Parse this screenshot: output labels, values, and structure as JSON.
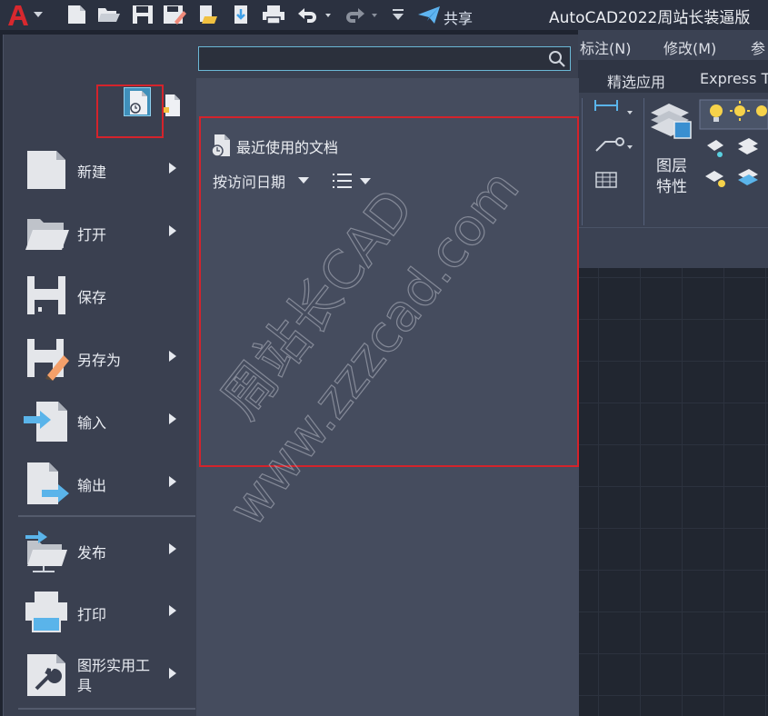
{
  "window": {
    "title": "AutoCAD2022周站长装逼版"
  },
  "quick_access": {
    "items": [
      "new-icon",
      "open-icon",
      "save-icon",
      "saveas-icon",
      "open-web-mobile-icon",
      "save-web-mobile-icon",
      "plot-icon",
      "undo-icon",
      "redo-icon",
      "customize-dropdown-icon"
    ],
    "share_label": "共享"
  },
  "menubar": {
    "items": [
      "标注(N)",
      "修改(M)",
      "参"
    ]
  },
  "ribbon": {
    "tabs": [
      "精选应用",
      "Express T"
    ],
    "layer_panel_label_line1": "图层",
    "layer_panel_label_line2": "特性"
  },
  "search": {
    "value": "",
    "placeholder": ""
  },
  "app_menu": {
    "items": [
      {
        "label": "新建",
        "icon": "new-doc-icon",
        "has_arrow": true
      },
      {
        "label": "打开",
        "icon": "open-folder-icon",
        "has_arrow": true
      },
      {
        "label": "保存",
        "icon": "save-disk-icon",
        "has_arrow": false
      },
      {
        "label": "另存为",
        "icon": "save-as-icon",
        "has_arrow": true
      },
      {
        "label": "输入",
        "icon": "import-icon",
        "has_arrow": true
      },
      {
        "label": "输出",
        "icon": "export-icon",
        "has_arrow": true
      },
      {
        "label": "发布",
        "icon": "publish-icon",
        "has_arrow": true
      },
      {
        "label": "打印",
        "icon": "print-icon",
        "has_arrow": true
      },
      {
        "label": "图形实用工具",
        "icon": "drawing-utilities-icon",
        "has_arrow": true
      }
    ]
  },
  "recent": {
    "title": "最近使用的文档",
    "sort_label": "按访问日期"
  },
  "watermark": {
    "line1": "周站长CAD",
    "line2": "www.zzzcad.com"
  },
  "colors": {
    "highlight": "#d4232b",
    "panel": "#454c5e",
    "menu": "#3a4050",
    "accent": "#6bb8d6"
  }
}
